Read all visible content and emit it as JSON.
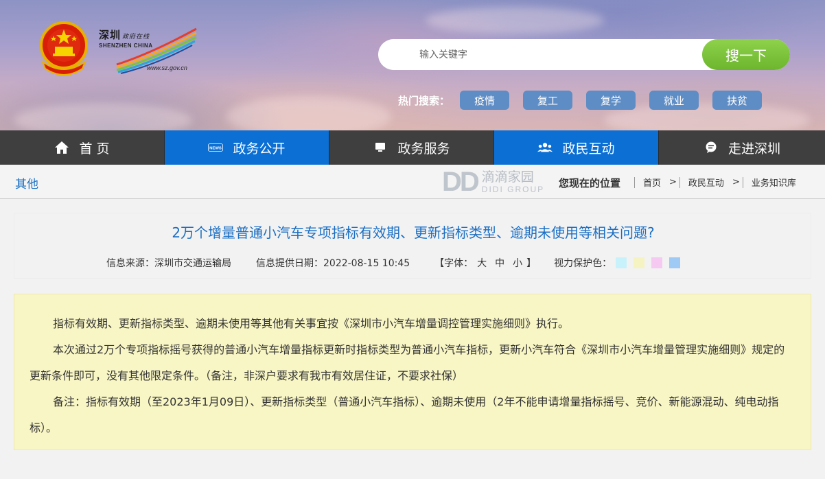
{
  "header": {
    "emblem_icon": "national-emblem-icon",
    "logo": {
      "cn_name": "深圳",
      "cn_sub": "政府在线",
      "en_name": "SHENZHEN CHINA",
      "url": "www.sz.gov.cn"
    },
    "search": {
      "placeholder": "输入关键字",
      "button_label": "搜一下",
      "button_color": "#7cc23a"
    },
    "hot_search": {
      "label": "热门搜索：",
      "tags": [
        "疫情",
        "复工",
        "复学",
        "就业",
        "扶贫"
      ],
      "tag_color": "#5e8cc4"
    }
  },
  "nav": {
    "items": [
      {
        "label": "首 页",
        "icon": "home-icon",
        "style": "dark"
      },
      {
        "label": "政务公开",
        "icon": "news-icon",
        "style": "blue"
      },
      {
        "label": "政务服务",
        "icon": "monitor-icon",
        "style": "dark"
      },
      {
        "label": "政民互动",
        "icon": "people-icon",
        "style": "blue"
      },
      {
        "label": "走进深圳",
        "icon": "chat-icon",
        "style": "dark"
      }
    ],
    "colors": {
      "dark": "#3f3f3f",
      "blue": "#0b6fd4"
    }
  },
  "breadcrumb_bar": {
    "section_title": "其他",
    "watermark": {
      "mark": "DD",
      "cn": "滴滴家园",
      "en": "DIDI GROUP"
    },
    "location_label": "您现在的位置",
    "crumbs": [
      "首页",
      "政民互动",
      "业务知识库"
    ],
    "separator": ">"
  },
  "article": {
    "title": "2万个增量普通小汽车专项指标有效期、更新指标类型、逾期未使用等相关问题?",
    "source": "信息来源：深圳市交通运输局",
    "date": "信息提供日期：2022-08-15 10:45",
    "font_label": "【字体：",
    "font_sizes": [
      "大",
      "中",
      "小"
    ],
    "font_close": "】",
    "eye_care_label": "视力保护色：",
    "eye_care_colors": [
      "#c8f2fb",
      "#f6f3c2",
      "#f6c9f2",
      "#9fcaf6"
    ],
    "paragraphs": [
      "指标有效期、更新指标类型、逾期未使用等其他有关事宜按《深圳市小汽车增量调控管理实施细则》执行。",
      "本次通过2万个专项指标摇号获得的普通小汽车增量指标更新时指标类型为普通小汽车指标，更新小汽车符合《深圳市小汽车增量管理实施细则》规定的更新条件即可，没有其他限定条件。（备注，非深户要求有我市有效居住证，不要求社保）",
      "备注：指标有效期（至2023年1月09日）、更新指标类型（普通小汽车指标）、逾期未使用（2年不能申请增量指标摇号、竞价、新能源混动、纯电动指标）。"
    ],
    "content_bg": "#f8f6c4"
  }
}
